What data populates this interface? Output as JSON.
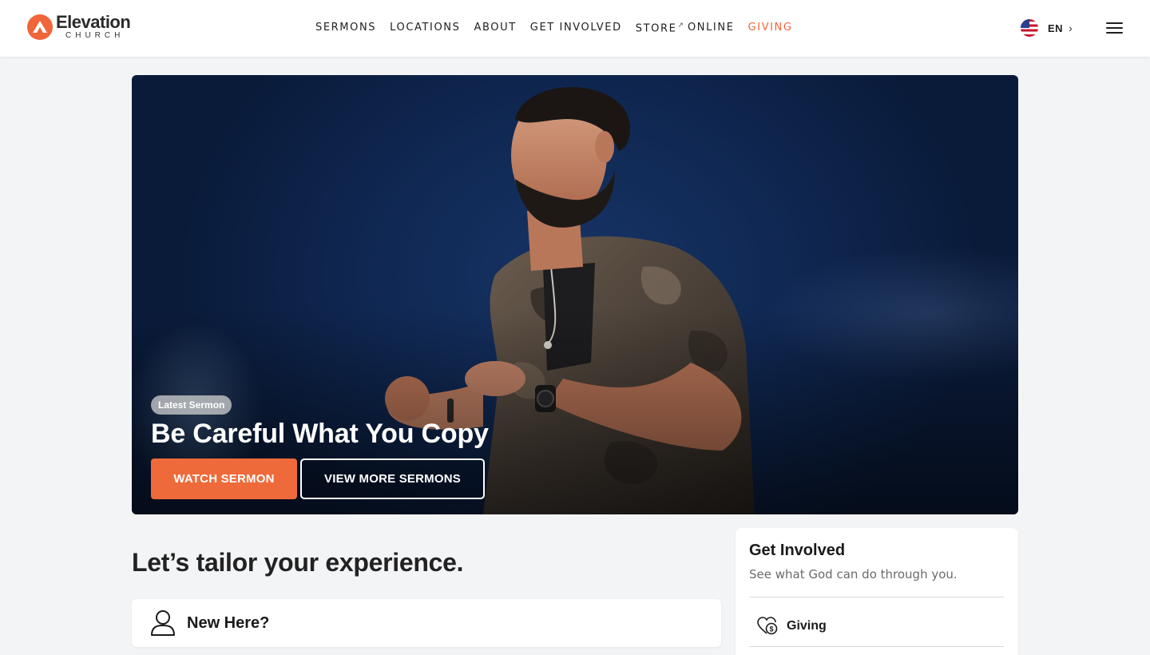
{
  "brand": {
    "name": "Elevation",
    "sub": "CHURCH",
    "accent": "#f0653a"
  },
  "nav": {
    "items": [
      {
        "label": "SERMONS"
      },
      {
        "label": "LOCATIONS"
      },
      {
        "label": "ABOUT"
      },
      {
        "label": "GET INVOLVED"
      },
      {
        "label": "STORE",
        "external": true
      },
      {
        "label": "ONLINE"
      },
      {
        "label": "GIVING",
        "highlight": true
      }
    ]
  },
  "language": {
    "code": "EN",
    "flag": "us-flag-icon"
  },
  "hero": {
    "badge": "Latest Sermon",
    "title": "Be Careful What You Copy",
    "primary_button": "WATCH SERMON",
    "secondary_button": "VIEW MORE SERMONS"
  },
  "tailor": {
    "heading": "Let’s tailor your experience.",
    "card_label": "New Here?",
    "card_icon": "person-icon"
  },
  "get_involved": {
    "title": "Get Involved",
    "subtitle": "See what God can do through you.",
    "items": [
      {
        "label": "Giving",
        "icon": "heart-dollar-icon"
      }
    ]
  }
}
